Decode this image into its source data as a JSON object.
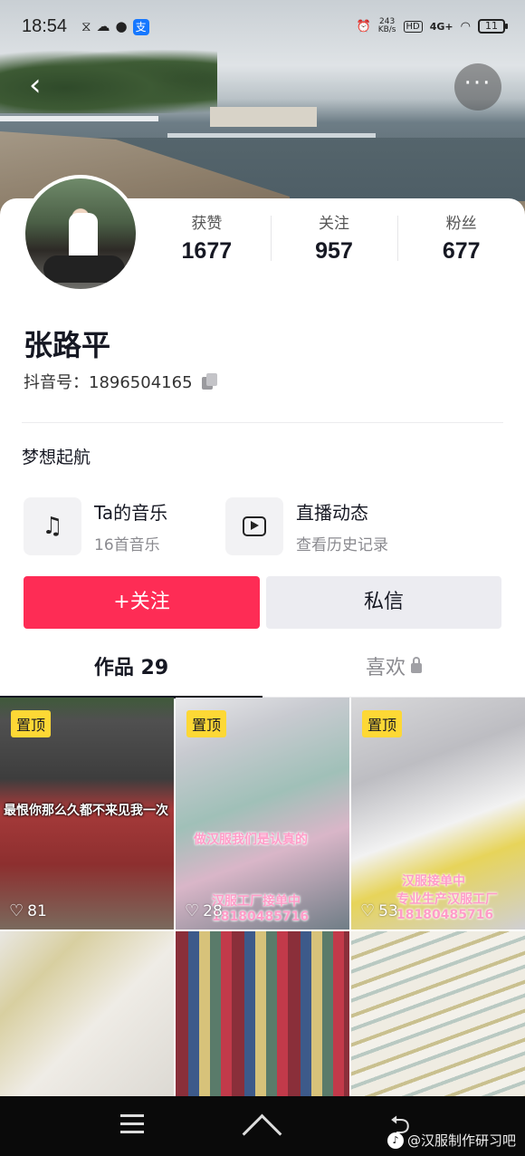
{
  "status_bar": {
    "time": "18:54",
    "net_speed": "243",
    "net_unit": "KB/s",
    "hd": "HD",
    "signal": "4G+",
    "battery": "11"
  },
  "profile": {
    "name": "张路平",
    "douyin_id_label": "抖音号：",
    "douyin_id": "1896504165",
    "bio": "梦想起航"
  },
  "stats": [
    {
      "label": "获赞",
      "value": "1677"
    },
    {
      "label": "关注",
      "value": "957"
    },
    {
      "label": "粉丝",
      "value": "677"
    }
  ],
  "features": {
    "music": {
      "title": "Ta的音乐",
      "subtitle": "16首音乐"
    },
    "live": {
      "title": "直播动态",
      "subtitle": "查看历史记录"
    }
  },
  "actions": {
    "follow": "+关注",
    "message": "私信"
  },
  "tabs": {
    "works": "作品 29",
    "likes": "喜欢"
  },
  "videos": [
    {
      "pinned": "置顶",
      "caption": "最恨你那么久都不来见我一次",
      "caption2": "",
      "likes": "81"
    },
    {
      "pinned": "置顶",
      "caption": "做汉服我们是认真的",
      "caption2": "汉服工厂接单中 18180485716",
      "likes": "28"
    },
    {
      "pinned": "置顶",
      "caption": "汉服接单中",
      "caption2": "专业生产汉服工厂 18180485716",
      "likes": "53"
    }
  ],
  "watermark": "@汉服制作研习吧",
  "colors": {
    "accent": "#fe2c55",
    "pin": "#fdd835"
  }
}
